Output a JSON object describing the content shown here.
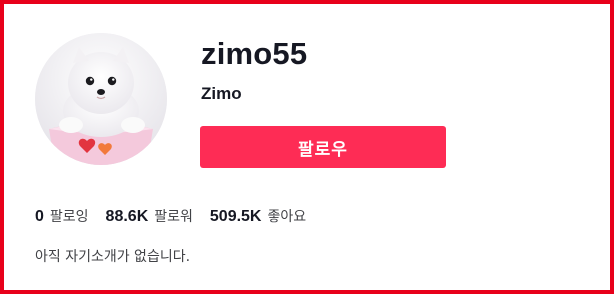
{
  "profile": {
    "username": "zimo55",
    "nickname": "Zimo",
    "avatar_icon": "pomeranian-puppy-photo",
    "follow_button_label": "팔로우",
    "stats": {
      "following": {
        "value": "0",
        "label": "팔로잉"
      },
      "followers": {
        "value": "88.6K",
        "label": "팔로워"
      },
      "likes": {
        "value": "509.5K",
        "label": "좋아요"
      }
    },
    "bio": "아직 자기소개가 없습니다."
  },
  "colors": {
    "accent": "#fe2c55",
    "frame_border": "#e8001a",
    "text_primary": "#161823",
    "text_secondary": "#414246"
  }
}
